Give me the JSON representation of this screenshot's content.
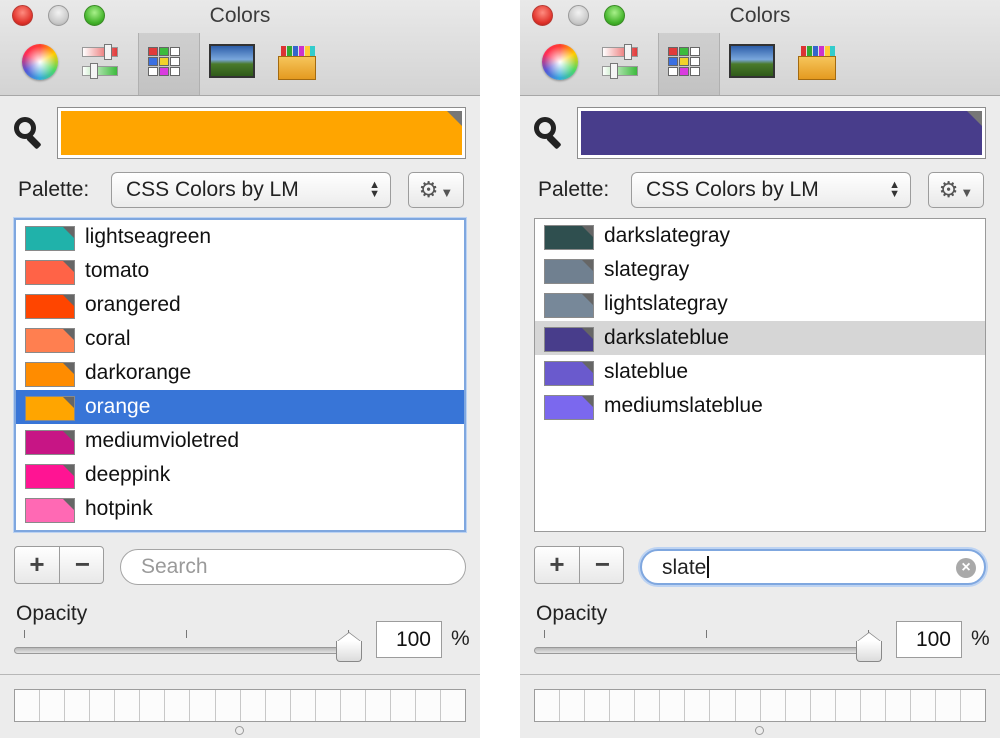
{
  "left_panel": {
    "title": "Colors",
    "current_color": "#ffa500",
    "palette_label": "Palette:",
    "palette_name": "CSS Colors by LM",
    "colors": [
      {
        "name": "lightseagreen",
        "hex": "#20b2aa",
        "state": "normal"
      },
      {
        "name": "tomato",
        "hex": "#ff6347",
        "state": "normal"
      },
      {
        "name": "orangered",
        "hex": "#ff4500",
        "state": "normal"
      },
      {
        "name": "coral",
        "hex": "#ff7f50",
        "state": "normal"
      },
      {
        "name": "darkorange",
        "hex": "#ff8c00",
        "state": "normal"
      },
      {
        "name": "orange",
        "hex": "#ffa500",
        "state": "selected-active"
      },
      {
        "name": "mediumvioletred",
        "hex": "#c71585",
        "state": "normal"
      },
      {
        "name": "deeppink",
        "hex": "#ff1493",
        "state": "normal"
      },
      {
        "name": "hotpink",
        "hex": "#ff69b4",
        "state": "normal"
      }
    ],
    "add_label": "+",
    "remove_label": "−",
    "search": {
      "value": "",
      "placeholder": "Search"
    },
    "opacity_label": "Opacity",
    "opacity_value": "100",
    "opacity_unit": "%"
  },
  "right_panel": {
    "title": "Colors",
    "current_color": "#483d8b",
    "palette_label": "Palette:",
    "palette_name": "CSS Colors by LM",
    "colors": [
      {
        "name": "darkslategray",
        "hex": "#2f4f4f",
        "state": "normal"
      },
      {
        "name": "slategray",
        "hex": "#708090",
        "state": "normal"
      },
      {
        "name": "lightslategray",
        "hex": "#778899",
        "state": "normal"
      },
      {
        "name": "darkslateblue",
        "hex": "#483d8b",
        "state": "selected-inactive"
      },
      {
        "name": "slateblue",
        "hex": "#6a5acd",
        "state": "normal"
      },
      {
        "name": "mediumslateblue",
        "hex": "#7b68ee",
        "state": "normal"
      }
    ],
    "add_label": "+",
    "remove_label": "−",
    "search": {
      "value": "slate",
      "placeholder": "Search"
    },
    "opacity_label": "Opacity",
    "opacity_value": "100",
    "opacity_unit": "%"
  },
  "toolbar_icons": [
    "color-wheel-icon",
    "color-sliders-icon",
    "color-palettes-icon",
    "image-palettes-icon",
    "crayons-icon"
  ],
  "colors": {
    "selection_active": "#3875d7",
    "selection_inactive": "#d6d6d6",
    "focus_ring": "#7fa7df"
  }
}
